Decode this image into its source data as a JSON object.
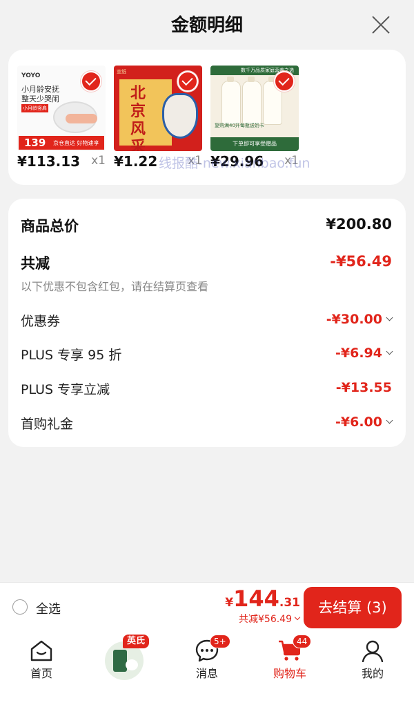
{
  "header": {
    "title": "金额明细"
  },
  "products": [
    {
      "price": "¥113.13",
      "qty": "x1",
      "brand": "YOYO",
      "line1": "小月龄安抚",
      "line2": "整天少哭闹",
      "tag": "小月龄竖肩",
      "promo_price": "139",
      "promo_text": "京仓直达 好物速享"
    },
    {
      "price": "¥1.22",
      "qty": "x1",
      "top_text": "宣纸",
      "title_text": "北京风采"
    },
    {
      "price": "¥29.96",
      "qty": "x1",
      "top_text": "数千万品质家庭营养之选",
      "mid_text": "复购满40升每瓶送奶卡",
      "bottom_text": "下单即可享受赠品"
    }
  ],
  "watermark": "线报酷-new.xianbao.fun",
  "summary": {
    "total_label": "商品总价",
    "total_value": "¥200.80",
    "discount_label": "共减",
    "discount_value": "-¥56.49",
    "note": "以下优惠不包含红包，请在结算页查看",
    "items": [
      {
        "label": "优惠券",
        "value": "-¥30.00",
        "expandable": true
      },
      {
        "label": "PLUS 专享 95 折",
        "value": "-¥6.94",
        "expandable": true
      },
      {
        "label": "PLUS 专享立减",
        "value": "-¥13.55",
        "expandable": false
      },
      {
        "label": "首购礼金",
        "value": "-¥6.00",
        "expandable": true
      }
    ]
  },
  "footer": {
    "select_all": "全选",
    "currency": "¥",
    "amount_int": "144",
    "amount_dec": ".31",
    "saved": "共减¥56.49",
    "checkout": "去结算 (3)"
  },
  "tabs": [
    {
      "label": "首页",
      "icon": "home-icon"
    },
    {
      "label": "",
      "icon": "promo-thumbnail",
      "tag": "英氏"
    },
    {
      "label": "消息",
      "icon": "message-icon",
      "badge": "5+"
    },
    {
      "label": "购物车",
      "icon": "cart-icon",
      "badge": "44",
      "active": true
    },
    {
      "label": "我的",
      "icon": "user-icon"
    }
  ],
  "colors": {
    "accent": "#e1251b",
    "background": "#f2f2f2"
  }
}
